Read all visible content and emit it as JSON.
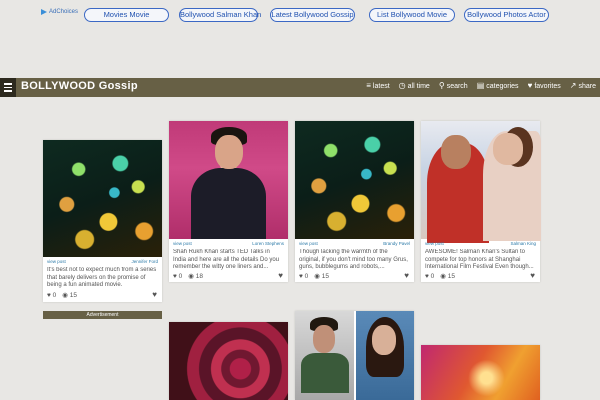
{
  "ads": {
    "adchoices_label": "AdChoices",
    "links": [
      "Movies Movie",
      "Bollywood Salman Khan",
      "Latest Bollywood Gossip",
      "List Bollywood Movie",
      "Bollywood Photos Actor"
    ]
  },
  "navbar": {
    "brand": "BOLLYWOOD Gossip",
    "items": [
      {
        "label": "latest",
        "icon": "bars-sort-icon"
      },
      {
        "label": "all time",
        "icon": "clock-icon"
      },
      {
        "label": "search",
        "icon": "search-icon"
      },
      {
        "label": "categories",
        "icon": "folder-icon"
      },
      {
        "label": "favorites",
        "icon": "heart-icon"
      },
      {
        "label": "share",
        "icon": "share-icon"
      }
    ],
    "colors": {
      "bar": "#676045",
      "menu": "#2d2a1e"
    }
  },
  "cards": [
    {
      "view_label": "view post",
      "author": "Jennifer Ford",
      "description": "It's best not to expect much from a series that barely delivers on the promise of being a fun animated movie.",
      "likes": "0",
      "views": "15"
    },
    {
      "view_label": "view post",
      "author": "Loren Stephens",
      "description": "Shah Rukh Khan starts TED Talks in India and here are all the details Do you remember the witty one liners and...",
      "likes": "0",
      "views": "18"
    },
    {
      "view_label": "view post",
      "author": "Brandy Pavel",
      "description": "Though lacking the warmth of the original, if you don't mind too many Grus, guns, bubblegums and robots,...",
      "likes": "0",
      "views": "15"
    },
    {
      "view_label": "view post",
      "author": "Salman King",
      "description": "AWESOME! Salman Khan's Sultan to compete for top honors at Shanghai International Film Festival Even though...",
      "likes": "0",
      "views": "15"
    }
  ],
  "advertisement_label": "Advertisement"
}
